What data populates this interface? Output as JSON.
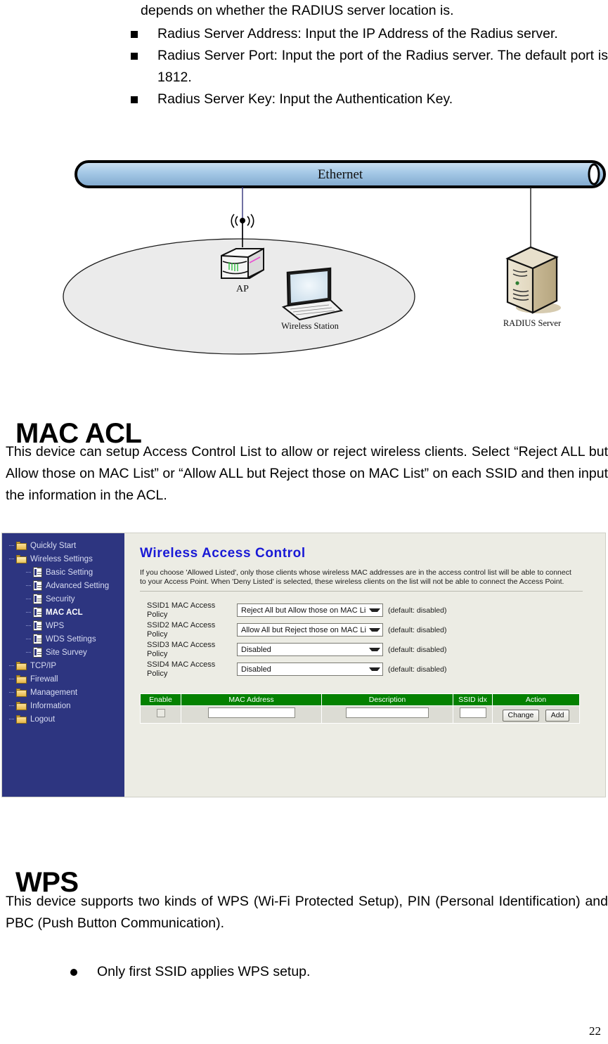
{
  "top_section": {
    "continuation_line": "depends on whether the RADIUS server location is.",
    "bullets": [
      "Radius Server Address: Input the IP Address of the Radius server.",
      "Radius Server Port: Input the port of the Radius server. The default port is 1812.",
      "Radius Server Key: Input the Authentication Key."
    ]
  },
  "diagram": {
    "ethernet_label": "Ethernet",
    "ap_label": "AP",
    "wireless_station_label": "Wireless Station",
    "radius_server_label": "RADIUS Server",
    "colors": {
      "ethernet_bar": "#9CC3E3",
      "cloud_fill": "#EBEBEB",
      "server_fill": "#D8CCAE",
      "link_line": "#33337A"
    }
  },
  "mac_acl": {
    "heading": "MAC ACL",
    "paragraph": "This device can setup Access Control List to allow or reject wireless clients. Select “Reject ALL but Allow those on MAC List” or “Allow ALL but Reject those on MAC List” on each SSID and then input the information in the ACL."
  },
  "admin_ui": {
    "colors": {
      "sidebar_bg": "#2D3580",
      "panel_bg": "#ECECE4",
      "title_blue": "#1919D6",
      "table_header_green": "#048100"
    },
    "sidebar": {
      "items": [
        {
          "label": "Quickly Start",
          "icon": "folder-icon",
          "level": 1,
          "selected": false
        },
        {
          "label": "Wireless Settings",
          "icon": "folder-open-icon",
          "level": 1,
          "selected": false
        },
        {
          "label": "Basic Setting",
          "icon": "page-icon",
          "level": 2,
          "selected": false
        },
        {
          "label": "Advanced Setting",
          "icon": "page-icon",
          "level": 2,
          "selected": false
        },
        {
          "label": "Security",
          "icon": "page-icon",
          "level": 2,
          "selected": false
        },
        {
          "label": "MAC ACL",
          "icon": "page-icon",
          "level": 2,
          "selected": true
        },
        {
          "label": "WPS",
          "icon": "page-icon",
          "level": 2,
          "selected": false
        },
        {
          "label": "WDS Settings",
          "icon": "page-icon",
          "level": 2,
          "selected": false
        },
        {
          "label": "Site Survey",
          "icon": "page-icon",
          "level": 2,
          "selected": false
        },
        {
          "label": "TCP/IP",
          "icon": "folder-icon",
          "level": 1,
          "selected": false
        },
        {
          "label": "Firewall",
          "icon": "folder-icon",
          "level": 1,
          "selected": false
        },
        {
          "label": "Management",
          "icon": "folder-icon",
          "level": 1,
          "selected": false
        },
        {
          "label": "Information",
          "icon": "folder-icon",
          "level": 1,
          "selected": false
        },
        {
          "label": "Logout",
          "icon": "folder-icon",
          "level": 1,
          "selected": false
        }
      ]
    },
    "main": {
      "title": "Wireless Access Control",
      "description": "If you choose 'Allowed Listed', only those clients whose wireless MAC addresses are in the access control list will be able to connect to your Access Point. When 'Deny Listed' is selected, these wireless clients on the list will not be able to connect the Access Point.",
      "policies": [
        {
          "label": "SSID1 MAC Access Policy",
          "value": "Reject All but Allow those on MAC List",
          "default_note": "(default: disabled)"
        },
        {
          "label": "SSID2 MAC Access Policy",
          "value": "Allow All but Reject those on MAC List",
          "default_note": "(default: disabled)"
        },
        {
          "label": "SSID3 MAC Access Policy",
          "value": "Disabled",
          "default_note": "(default: disabled)"
        },
        {
          "label": "SSID4 MAC Access Policy",
          "value": "Disabled",
          "default_note": "(default: disabled)"
        }
      ],
      "policy_options": [
        "Disabled",
        "Allow All but Reject those on MAC List",
        "Reject All but Allow those on MAC List"
      ],
      "table": {
        "headers": [
          "Enable",
          "MAC Address",
          "Description",
          "SSID idx",
          "Action"
        ],
        "row": {
          "enable_checked": false,
          "mac_address": "",
          "description": "",
          "ssid_idx": "",
          "buttons": [
            "Change",
            "Add"
          ]
        }
      }
    }
  },
  "wps": {
    "heading": "WPS",
    "paragraph": "This device supports two kinds of WPS (Wi-Fi Protected Setup), PIN (Personal Identification) and PBC (Push Button Communication).",
    "bullets": [
      "Only first SSID applies WPS setup."
    ]
  },
  "page_number": "22"
}
